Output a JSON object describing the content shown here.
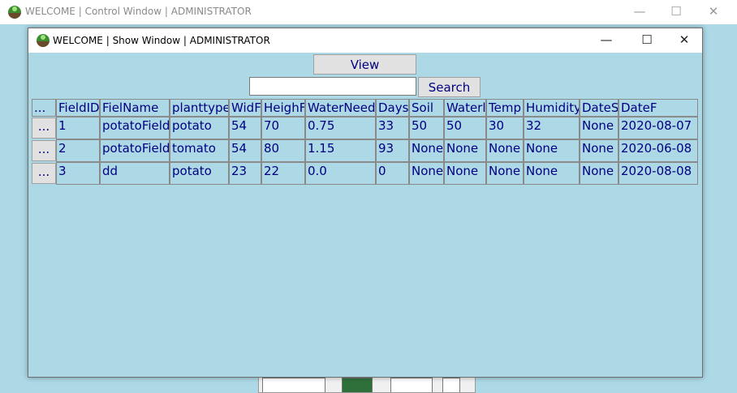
{
  "outer_window": {
    "title": "WELCOME | Control Window | ADMINISTRATOR",
    "minimize": "—",
    "maximize": "☐",
    "close": "✕"
  },
  "inner_window": {
    "title": "WELCOME | Show Window | ADMINISTRATOR",
    "minimize": "—",
    "maximize": "☐",
    "close": "✕"
  },
  "toolbar": {
    "view_label": "View",
    "search_label": "Search",
    "search_value": "",
    "search_placeholder": ""
  },
  "table": {
    "headers": [
      "...",
      "FieldID",
      "FielName",
      "planttype",
      "WidF",
      "HeighF",
      "WaterNeed",
      "Days",
      "Soil",
      "Waterl",
      "Temp",
      "Humidity",
      "DateS",
      "DateF"
    ],
    "rows": [
      {
        "button": "...",
        "cells": [
          "1",
          "potatoField",
          "potato",
          "54",
          "70",
          "0.75",
          "33",
          "50",
          "50",
          "30",
          "32",
          "None",
          "2020-08-07"
        ]
      },
      {
        "button": "...",
        "cells": [
          "2",
          "potatoField",
          "tomato",
          "54",
          "80",
          "1.15",
          "93",
          "None",
          "None",
          "None",
          "None",
          "None",
          "2020-06-08"
        ]
      },
      {
        "button": "...",
        "cells": [
          "3",
          "dd",
          "potato",
          "23",
          "22",
          "0.0",
          "0",
          "None",
          "None",
          "None",
          "None",
          "None",
          "2020-08-08"
        ]
      }
    ]
  },
  "colors": {
    "background": "#add8e6",
    "text": "#000080",
    "button": "#e1e1e1"
  }
}
